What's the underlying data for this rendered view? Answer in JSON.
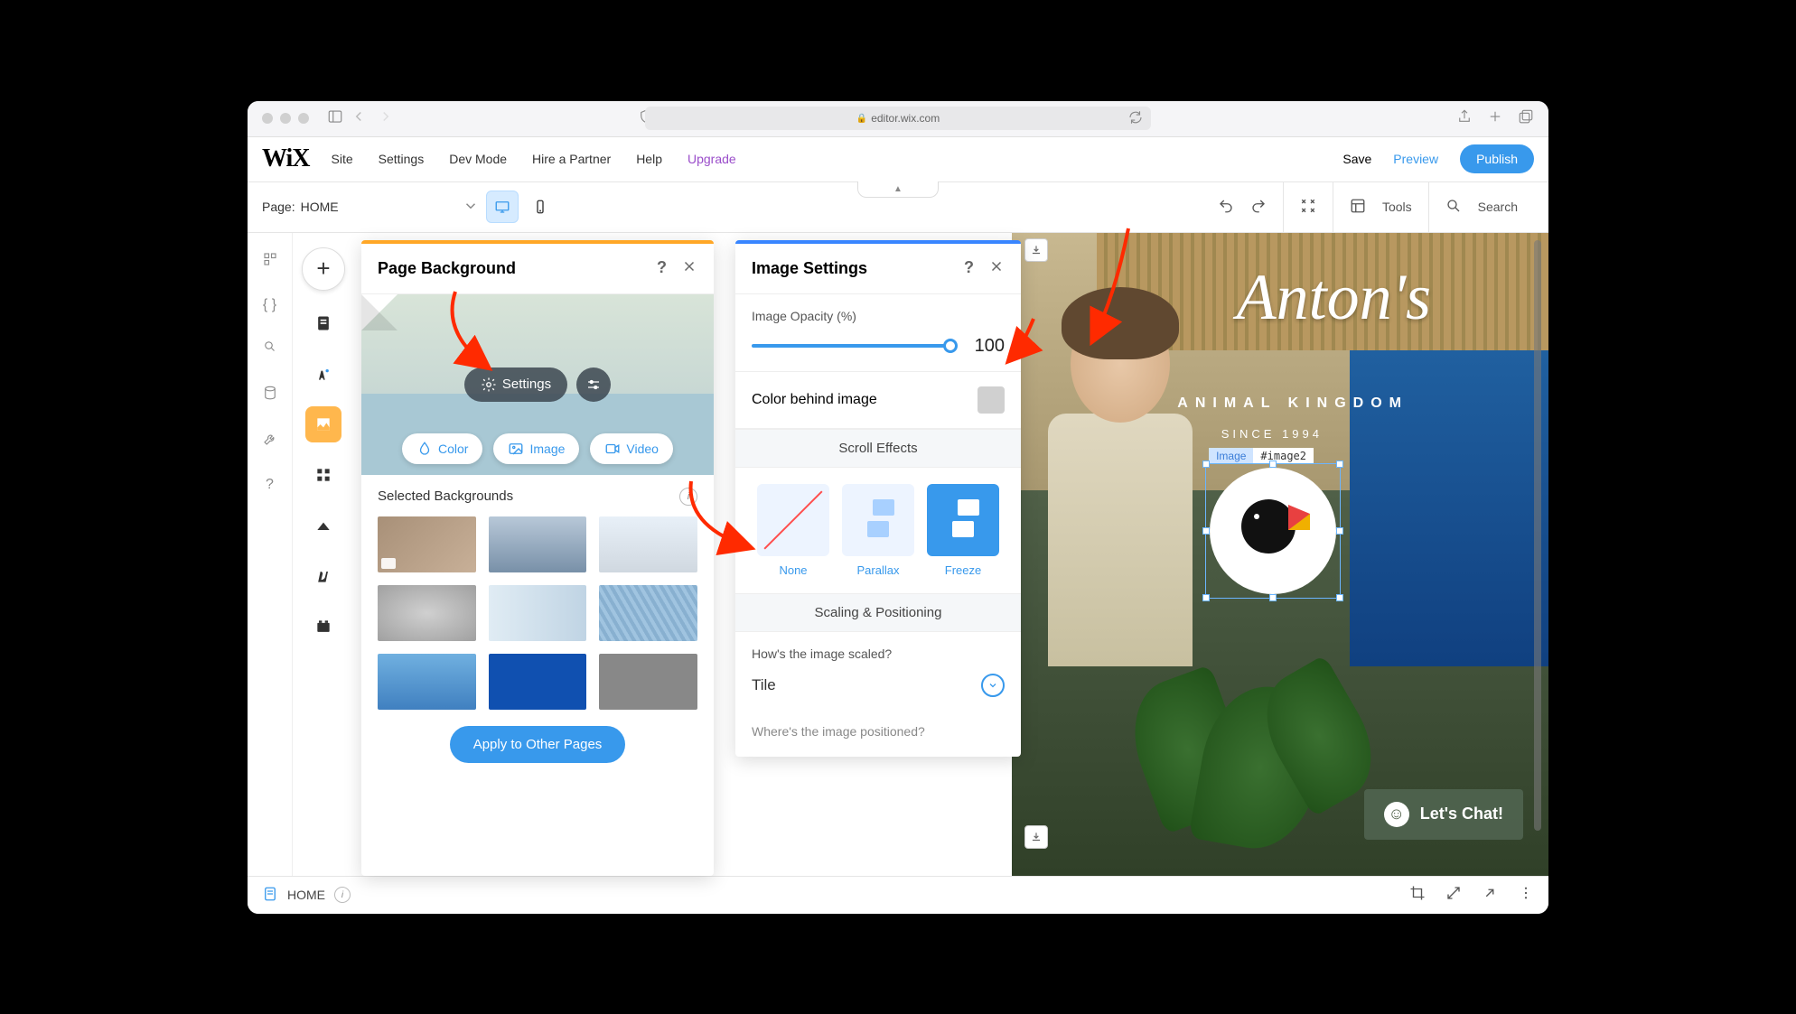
{
  "browser": {
    "url": "editor.wix.com"
  },
  "topmenu": {
    "items": [
      "Site",
      "Settings",
      "Dev Mode",
      "Hire a Partner",
      "Help"
    ],
    "upgrade": "Upgrade",
    "save": "Save",
    "preview": "Preview",
    "publish": "Publish"
  },
  "toolbar": {
    "page_prefix": "Page:",
    "page_name": "HOME",
    "tools": "Tools",
    "search": "Search"
  },
  "bg_panel": {
    "title": "Page Background",
    "settings_label": "Settings",
    "type_color": "Color",
    "type_image": "Image",
    "type_video": "Video",
    "selected_title": "Selected Backgrounds",
    "apply_btn": "Apply to Other Pages"
  },
  "img_panel": {
    "title": "Image Settings",
    "opacity_label": "Image Opacity (%)",
    "opacity_value": "100",
    "color_behind_label": "Color behind image",
    "scroll_effects_title": "Scroll Effects",
    "effects": {
      "none": "None",
      "parallax": "Parallax",
      "freeze": "Freeze"
    },
    "scaling_title": "Scaling & Positioning",
    "scale_question": "How's the image scaled?",
    "scale_value": "Tile",
    "position_question": "Where's the image positioned?"
  },
  "canvas": {
    "hero_title": "Anton's",
    "hero_sub": "ANIMAL KINGDOM",
    "hero_since": "SINCE 1994",
    "sel_type": "Image",
    "sel_id": "#image2",
    "chat_label": "Let's Chat!"
  },
  "bottombar": {
    "page": "HOME"
  }
}
